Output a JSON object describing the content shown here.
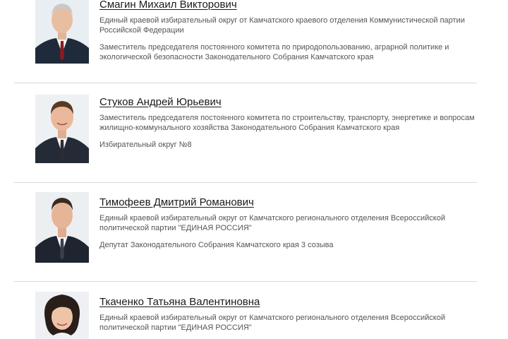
{
  "deputies": [
    {
      "name": "Смагин Михаил Викторович",
      "lines": [
        "Единый краевой избирательный округ от Камчатского краевого отделения Коммунистической партии Российской Федерации",
        "Заместитель председателя постоянного комитета по природопользованию, аграрной политике и экологической безопасности Законодательного Собрания Камчатского края"
      ],
      "photo": "portrait-gray-haired-man"
    },
    {
      "name": "Стуков Андрей Юрьевич",
      "lines": [
        "Заместитель председателя постоянного комитета по строительству, транспорту, энергетике и вопросам жилищно-коммунального хозяйства Законодательного Собрания Камчатского края",
        "Избирательный округ №8"
      ],
      "photo": "portrait-smiling-man"
    },
    {
      "name": "Тимофеев Дмитрий Романович",
      "lines": [
        "Единый краевой избирательный округ от Камчатского регионального отделения Всероссийской политической партии \"ЕДИНАЯ РОССИЯ\"",
        "Депутат Законодательного Собрания Камчатского края 3 созыва"
      ],
      "photo": "portrait-young-man"
    },
    {
      "name": "Ткаченко Татьяна Валентиновна",
      "lines": [
        "Единый краевой избирательный округ от Камчатского регионального отделения Всероссийской политической партии \"ЕДИНАЯ РОССИЯ\""
      ],
      "photo": "portrait-woman"
    }
  ]
}
